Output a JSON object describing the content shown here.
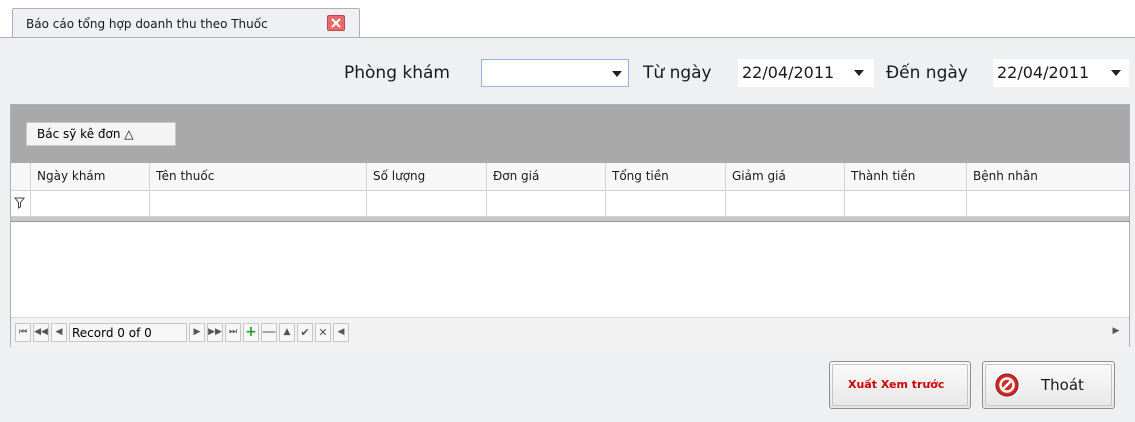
{
  "tab": {
    "title": "Báo cáo tổng hợp doanh thu theo Thuốc"
  },
  "filters": {
    "clinic_label": "Phòng khám",
    "clinic_value": "",
    "from_label": "Từ ngày",
    "from_date": "22/04/2011",
    "to_label": "Đến ngày",
    "to_date": "22/04/2011"
  },
  "grid": {
    "group_by": "Bác sỹ kê đơn △",
    "columns": [
      "Ngày khám",
      "Tên thuốc",
      "Số lượng",
      "Đơn  giá",
      "Tổng tiền",
      "Giảm giá",
      "Thành tiền",
      "Bệnh nhân"
    ],
    "rows": []
  },
  "navigator": {
    "record_text": "Record 0 of 0"
  },
  "buttons": {
    "preview": "Xuất Xem trước",
    "exit": "Thoát"
  },
  "colors": {
    "accent_red": "#cc0000",
    "group_panel": "#a9a9a9",
    "nav_green": "#2a9a2a"
  }
}
